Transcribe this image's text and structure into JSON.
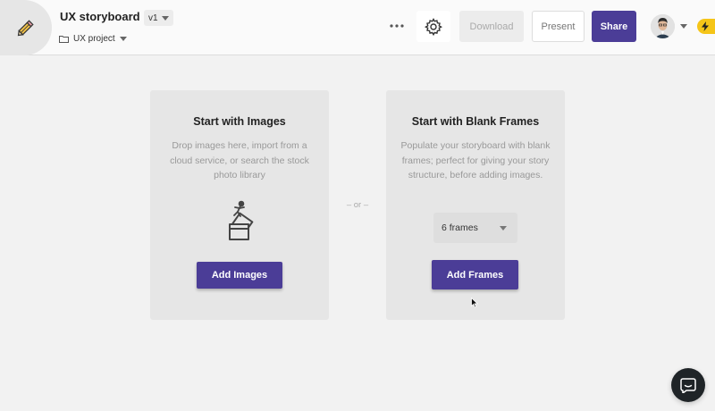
{
  "header": {
    "project_title": "UX storyboard",
    "version": "v1",
    "project_folder": "UX project",
    "download_label": "Download",
    "present_label": "Present",
    "share_label": "Share"
  },
  "main": {
    "images_card": {
      "title": "Start with Images",
      "description": "Drop images here, import from a cloud service, or search the stock photo library",
      "button_label": "Add Images"
    },
    "or_label": "– or –",
    "frames_card": {
      "title": "Start with Blank Frames",
      "description": "Populate your storyboard with blank frames; perfect for giving your story structure, before adding images.",
      "frames_value": "6 frames",
      "button_label": "Add Frames"
    }
  },
  "colors": {
    "accent": "#4b3d97",
    "background": "#f2f2f2",
    "card": "#e6e6e6",
    "badge": "#f5c518"
  },
  "icons": [
    "pencil-logo-icon",
    "chevron-down-icon",
    "folder-icon",
    "more-icon",
    "gear-icon",
    "lightning-icon",
    "images-icon",
    "cursor-icon",
    "chat-icon"
  ]
}
